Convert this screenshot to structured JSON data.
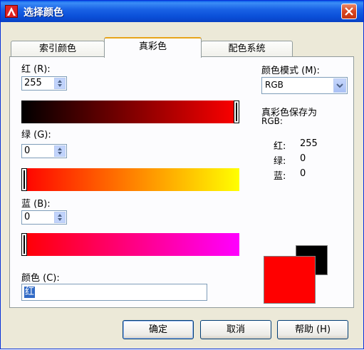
{
  "window": {
    "title": "选择颜色"
  },
  "tabs": [
    {
      "label": "索引颜色"
    },
    {
      "label": "真彩色"
    },
    {
      "label": "配色系统"
    }
  ],
  "red": {
    "label": "红 (R):",
    "value": "255",
    "slider_fraction": 1.0
  },
  "green": {
    "label": "绿 (G):",
    "value": "0",
    "slider_fraction": 0.0
  },
  "blue": {
    "label": "蓝 (B):",
    "value": "0",
    "slider_fraction": 0.0
  },
  "color_mode": {
    "label": "颜色模式 (M):",
    "value": "RGB"
  },
  "save_as": {
    "line1": "真彩色保存为",
    "line2": "RGB:",
    "rows": [
      {
        "name": "红:",
        "value": "255"
      },
      {
        "name": "绿:",
        "value": "0"
      },
      {
        "name": "蓝:",
        "value": "0"
      }
    ]
  },
  "color_field": {
    "label": "颜色 (C):",
    "value": "红"
  },
  "swatch": {
    "new_color": "#ff0000",
    "old_color": "#000000"
  },
  "buttons": {
    "ok": "确定",
    "cancel": "取消",
    "help": "帮助 (H)"
  }
}
